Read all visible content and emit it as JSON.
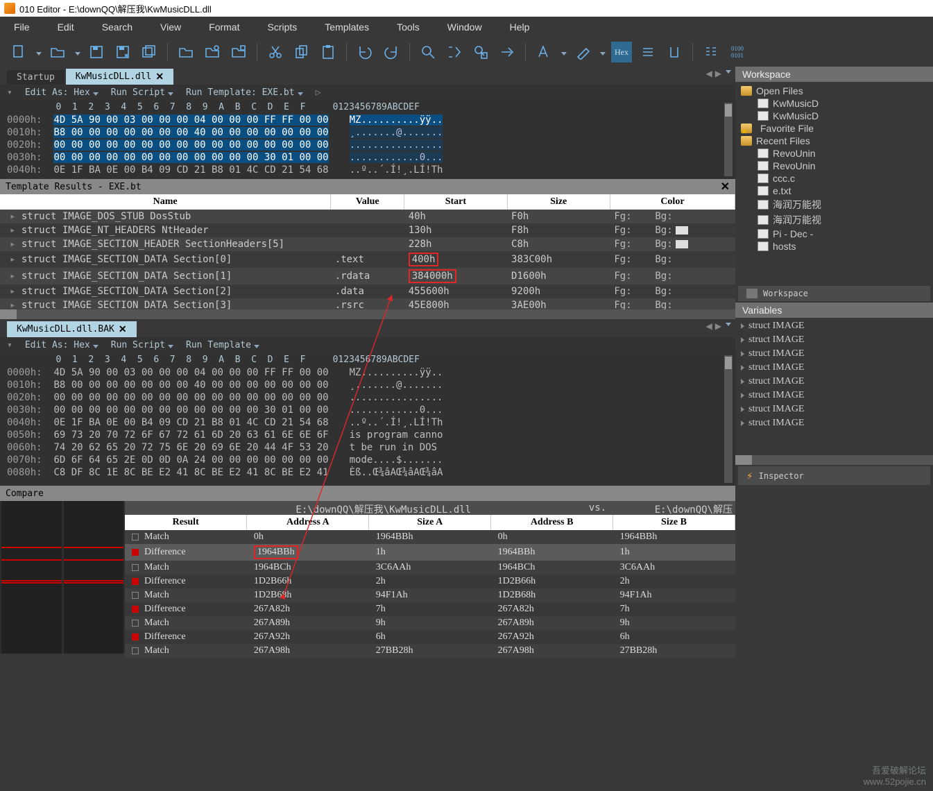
{
  "title": "010 Editor - E:\\downQQ\\解压我\\KwMusicDLL.dll",
  "menu": [
    "File",
    "Edit",
    "Search",
    "View",
    "Format",
    "Scripts",
    "Templates",
    "Tools",
    "Window",
    "Help"
  ],
  "tabs": {
    "startup": "Startup",
    "active": "KwMusicDLL.dll"
  },
  "hex_toolbar": {
    "editas": "Edit As: Hex",
    "runscript": "Run Script",
    "runtpl_a": "Run Template: EXE.bt",
    "runtpl_b": "Run Template"
  },
  "hex_colhdr": "0123456789ABCDEF",
  "hex_top": {
    "offsets": [
      "0000h:",
      "0010h:",
      "0020h:",
      "0030h:",
      "0040h:"
    ],
    "bytes": [
      "4D 5A 90 00 03 00 00 00 04 00 00 00 FF FF 00 00",
      "B8 00 00 00 00 00 00 00 40 00 00 00 00 00 00 00",
      "00 00 00 00 00 00 00 00 00 00 00 00 00 00 00 00",
      "00 00 00 00 00 00 00 00 00 00 00 00 30 01 00 00",
      "0E 1F BA 0E 00 B4 09 CD 21 B8 01 4C CD 21 54 68"
    ],
    "ascii": [
      "MZ..........ÿÿ..",
      "¸.......@.......",
      "................",
      "............0...",
      "..º..´.Í!¸.LÍ!Th"
    ],
    "selectedRows": 4
  },
  "tplres": {
    "title": "Template Results - EXE.bt",
    "headers": [
      "Name",
      "Value",
      "Start",
      "Size",
      "Color"
    ],
    "rows": [
      {
        "name": "struct IMAGE_DOS_STUB DosStub",
        "value": "",
        "start": "40h",
        "size": "F0h",
        "fg": "Fg:",
        "bg": "Bg:",
        "sw": false
      },
      {
        "name": "struct IMAGE_NT_HEADERS NtHeader",
        "value": "",
        "start": "130h",
        "size": "F8h",
        "fg": "Fg:",
        "bg": "Bg:",
        "sw": true
      },
      {
        "name": "struct IMAGE_SECTION_HEADER SectionHeaders[5]",
        "value": "",
        "start": "228h",
        "size": "C8h",
        "fg": "Fg:",
        "bg": "Bg:",
        "sw": true
      },
      {
        "name": "struct IMAGE_SECTION_DATA Section[0]",
        "value": ".text",
        "start": "400h",
        "size": "383C00h",
        "fg": "Fg:",
        "bg": "Bg:",
        "sw": false,
        "startbox": true
      },
      {
        "name": "struct IMAGE_SECTION_DATA Section[1]",
        "value": ".rdata",
        "start": "384000h",
        "size": "D1600h",
        "fg": "Fg:",
        "bg": "Bg:",
        "sw": false,
        "startbox": true
      },
      {
        "name": "struct IMAGE_SECTION_DATA Section[2]",
        "value": ".data",
        "start": "455600h",
        "size": "9200h",
        "fg": "Fg:",
        "bg": "Bg:",
        "sw": false
      },
      {
        "name": "struct IMAGE_SECTION_DATA Section[3]",
        "value": ".rsrc",
        "start": "45E800h",
        "size": "3AE00h",
        "fg": "Fg:",
        "bg": "Bg:",
        "sw": false
      }
    ]
  },
  "tabs2": {
    "active": "KwMusicDLL.dll.BAK"
  },
  "hex_bot": {
    "offsets": [
      "0000h:",
      "0010h:",
      "0020h:",
      "0030h:",
      "0040h:",
      "0050h:",
      "0060h:",
      "0070h:",
      "0080h:"
    ],
    "bytes": [
      "4D 5A 90 00 03 00 00 00 04 00 00 00 FF FF 00 00",
      "B8 00 00 00 00 00 00 00 40 00 00 00 00 00 00 00",
      "00 00 00 00 00 00 00 00 00 00 00 00 00 00 00 00",
      "00 00 00 00 00 00 00 00 00 00 00 00 30 01 00 00",
      "0E 1F BA 0E 00 B4 09 CD 21 B8 01 4C CD 21 54 68",
      "69 73 20 70 72 6F 67 72 61 6D 20 63 61 6E 6E 6F",
      "74 20 62 65 20 72 75 6E 20 69 6E 20 44 4F 53 20",
      "6D 6F 64 65 2E 0D 0D 0A 24 00 00 00 00 00 00 00",
      "C8 DF 8C 1E 8C BE E2 41 8C BE E2 41 8C BE E2 41"
    ],
    "ascii": [
      "MZ..........ÿÿ..",
      "¸.......@.......",
      "................",
      "............0...",
      "..º..´.Í!¸.LÍ!Th",
      "is program canno",
      "t be run in DOS ",
      "mode....$.......",
      "Èß..Œ¾âAŒ¾âAŒ¾âA"
    ]
  },
  "compare": {
    "title": "Compare",
    "fileA": "E:\\downQQ\\解压我\\KwMusicDLL.dll",
    "vs": "vs.",
    "fileB": "E:\\downQQ\\解压",
    "headers": [
      "Result",
      "Address A",
      "Size A",
      "Address B",
      "Size B"
    ],
    "rows": [
      {
        "res": "Match",
        "aa": "0h",
        "sa": "1964BBh",
        "ab": "0h",
        "sb": "1964BBh",
        "diff": false
      },
      {
        "res": "Difference",
        "aa": "1964BBh",
        "sa": "1h",
        "ab": "1964BBh",
        "sb": "1h",
        "diff": true,
        "sel": true,
        "aabox": true
      },
      {
        "res": "Match",
        "aa": "1964BCh",
        "sa": "3C6AAh",
        "ab": "1964BCh",
        "sb": "3C6AAh",
        "diff": false
      },
      {
        "res": "Difference",
        "aa": "1D2B66h",
        "sa": "2h",
        "ab": "1D2B66h",
        "sb": "2h",
        "diff": true
      },
      {
        "res": "Match",
        "aa": "1D2B68h",
        "sa": "94F1Ah",
        "ab": "1D2B68h",
        "sb": "94F1Ah",
        "diff": false
      },
      {
        "res": "Difference",
        "aa": "267A82h",
        "sa": "7h",
        "ab": "267A82h",
        "sb": "7h",
        "diff": true
      },
      {
        "res": "Match",
        "aa": "267A89h",
        "sa": "9h",
        "ab": "267A89h",
        "sb": "9h",
        "diff": false
      },
      {
        "res": "Difference",
        "aa": "267A92h",
        "sa": "6h",
        "ab": "267A92h",
        "sb": "6h",
        "diff": true
      },
      {
        "res": "Match",
        "aa": "267A98h",
        "sa": "27BB28h",
        "ab": "267A98h",
        "sb": "27BB28h",
        "diff": false
      }
    ]
  },
  "workspace": {
    "title": "Workspace",
    "open": "Open Files",
    "open_items": [
      "KwMusicD",
      "KwMusicD"
    ],
    "fav": "Favorite File",
    "recent": "Recent Files",
    "recent_items": [
      "RevoUnin",
      "RevoUnin",
      "ccc.c",
      "e.txt",
      "海润万能视",
      "海润万能视",
      "Pi - Dec -",
      "hosts"
    ],
    "btn": "Workspace"
  },
  "variables": {
    "title": "Variables",
    "rows": [
      "struct IMAGE",
      "struct IMAGE",
      "struct IMAGE",
      "struct IMAGE",
      "struct IMAGE",
      "struct IMAGE",
      "struct IMAGE",
      "struct IMAGE"
    ]
  },
  "inspector": "Inspector",
  "watermark": {
    "l1": "吾爱破解论坛",
    "l2": "www.52pojie.cn"
  },
  "chart_data": null
}
